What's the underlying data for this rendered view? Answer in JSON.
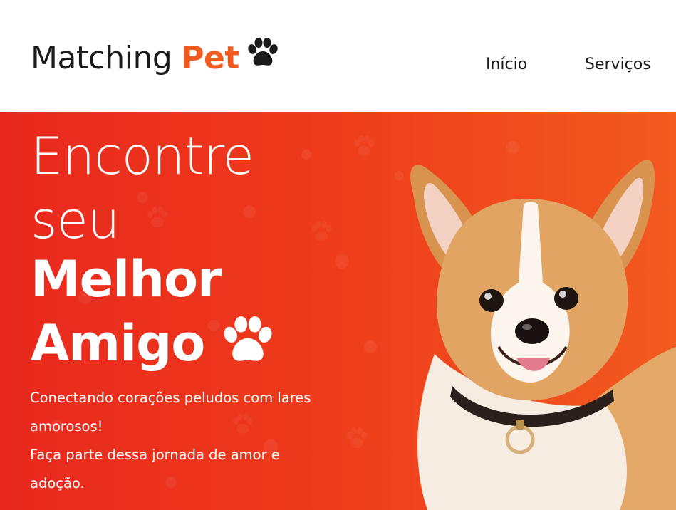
{
  "header": {
    "logo_text": "Matching",
    "logo_accent": "Pet",
    "logo_icon": "paw-icon",
    "nav": [
      {
        "label": "Início"
      },
      {
        "label": "Serviços"
      }
    ]
  },
  "hero": {
    "headline_line1": "Encontre",
    "headline_line2": "seu",
    "headline_line3": "Melhor",
    "headline_line4": "Amigo",
    "headline_icon": "paw-icon",
    "subtitle_line1": "Conectando corações peludos com lares amorosos!",
    "subtitle_line2": "Faça parte dessa jornada de amor e adoção.",
    "image": "corgi-dog-photo"
  },
  "colors": {
    "accent": "#f25a1f",
    "hero_start": "#e8281d",
    "hero_end": "#f25a1f",
    "text_dark": "#1a1a1a",
    "text_light": "#ffffff"
  }
}
